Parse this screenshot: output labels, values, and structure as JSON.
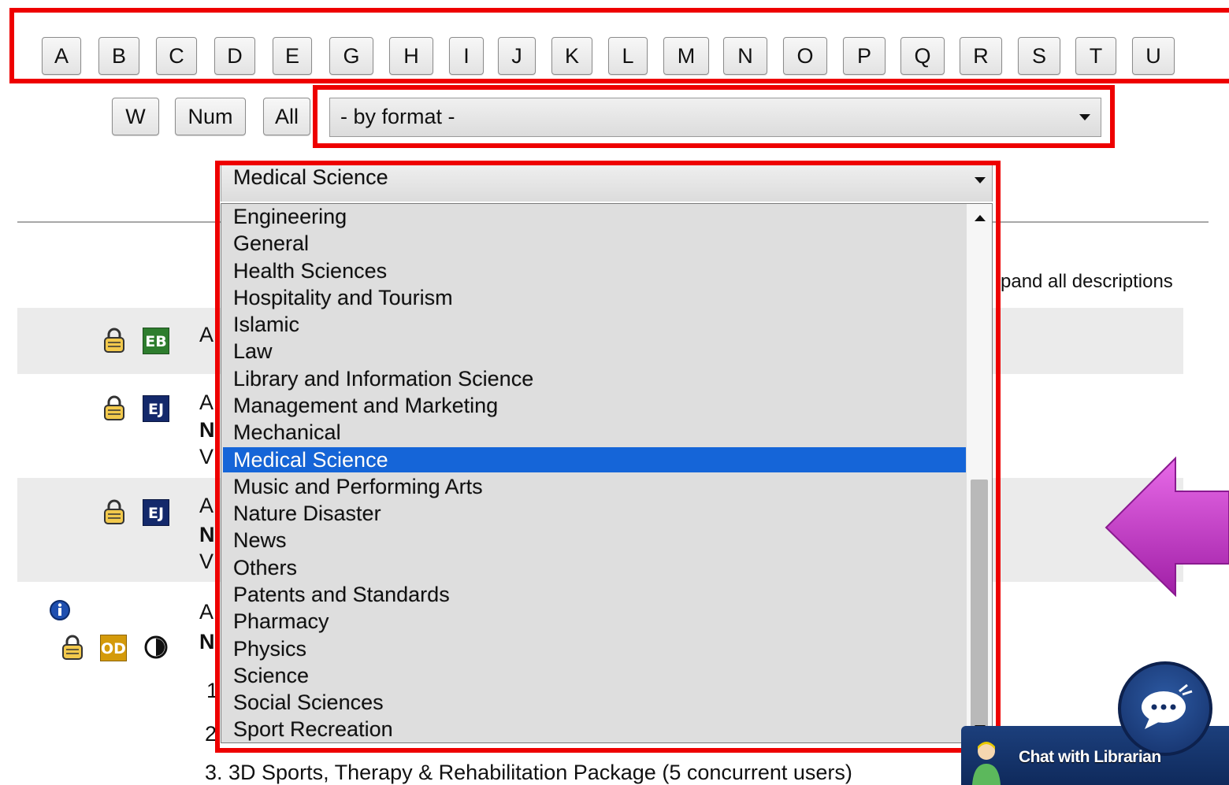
{
  "alpha_row1": [
    "A",
    "B",
    "C",
    "D",
    "E",
    "G",
    "H",
    "I",
    "J",
    "K",
    "L",
    "M",
    "N",
    "O",
    "P",
    "Q",
    "R",
    "S",
    "T",
    "U"
  ],
  "alpha_row2": [
    "W",
    "Num",
    "All"
  ],
  "format_select": {
    "value": "- by format -"
  },
  "subject_select": {
    "value": "Medical Science",
    "options": [
      "Engineering",
      "General",
      "Health Sciences",
      "Hospitality and Tourism",
      "Islamic",
      "Law",
      "Library and Information Science",
      "Management and Marketing",
      "Mechanical",
      "Medical Science",
      "Music and Performing Arts",
      "Nature Disaster",
      "News",
      "Others",
      "Patents and Standards",
      "Pharmacy",
      "Physics",
      "Science",
      "Social Sciences",
      "Sport Recreation"
    ],
    "selected_index": 9
  },
  "expand_link": "pand all descriptions",
  "background_rows": {
    "row1_letter": "A",
    "row2_letters": [
      "A",
      "N",
      "V"
    ],
    "row3_letters": [
      "A",
      "N",
      "V"
    ],
    "row4_letters": [
      "A",
      "N"
    ],
    "list_fragments": [
      "1",
      "2"
    ],
    "item3": "3. 3D Sports, Therapy & Rehabilitation Package (5 concurrent users)"
  },
  "badges": {
    "eb": "EB",
    "ej": "EJ",
    "od": "OD"
  },
  "chat": {
    "label": "Chat with Librarian"
  },
  "colors": {
    "highlight": "#ee0000",
    "selected": "#1565d8",
    "arrow": "#c836c8"
  },
  "icons": [
    "lock-icon",
    "info-icon",
    "open-access-icon",
    "chevron-down-icon",
    "chat-icon",
    "left-arrow-icon"
  ]
}
